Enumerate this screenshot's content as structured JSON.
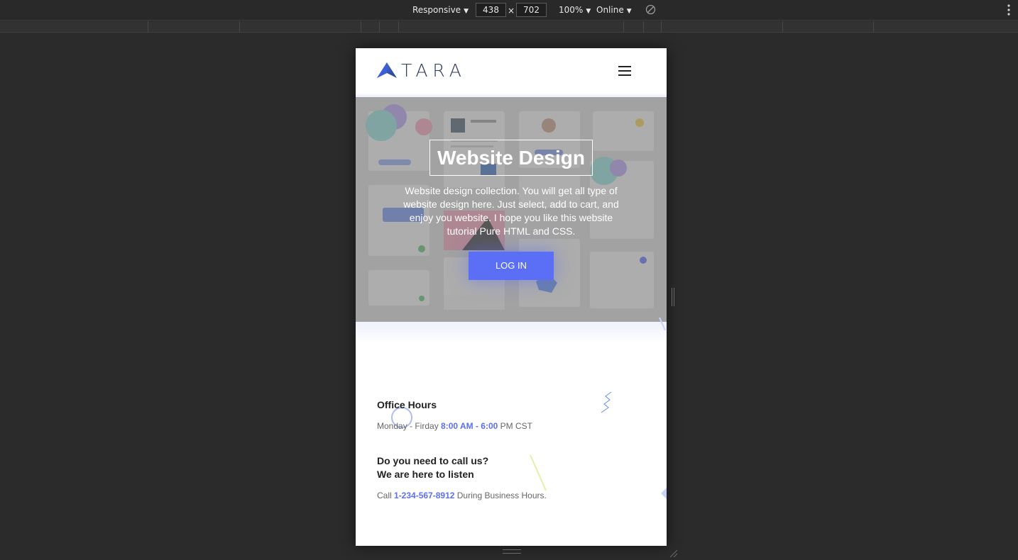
{
  "devtools": {
    "device_mode": "Responsive",
    "width": "438",
    "height": "702",
    "times": "×",
    "zoom": "100%",
    "network": "Online"
  },
  "site": {
    "logo_text": "TARA",
    "hero": {
      "title": "Website Design",
      "description": "Website design collection. You will get all type of website design here. Just select, add to cart, and enjoy you website. I hope you like this website tutorial Pure HTML and CSS.",
      "button_label": "LOG IN"
    },
    "office": {
      "heading": "Office Hours",
      "days": "Monday - Firday",
      "hours": "8:00 AM - 6:00",
      "suffix": "PM CST"
    },
    "call": {
      "heading_line1": "Do you need to call us?",
      "heading_line2": "We are here to listen",
      "prefix": "Call",
      "phone": "1-234-567-8912",
      "suffix": "During Business Hours."
    }
  },
  "colors": {
    "accent": "#5b6ef6",
    "devtools_bg": "#292929",
    "page_bg": "#2b2b2b"
  }
}
